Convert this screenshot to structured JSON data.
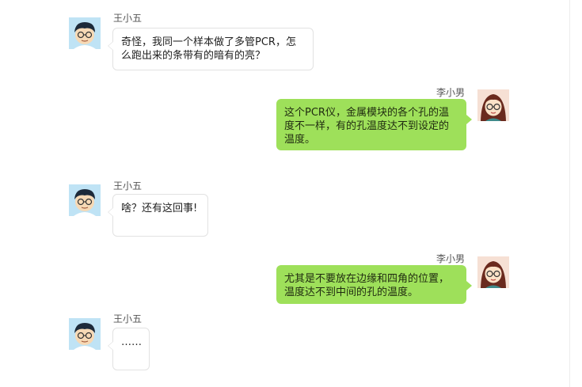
{
  "colors": {
    "left_bubble_bg": "#ffffff",
    "left_bubble_border": "#e2e2e2",
    "right_bubble_bg": "#9ee05a",
    "name_text": "#555555"
  },
  "participants": {
    "left": {
      "name": "王小五",
      "avatar_icon": "boy-with-glasses-avatar-icon"
    },
    "right": {
      "name": "李小男",
      "avatar_icon": "girl-with-glasses-avatar-icon"
    }
  },
  "messages": [
    {
      "side": "left",
      "name": "王小五",
      "text": "奇怪，我同一个样本做了多管PCR，怎么跑出来的条带有的暗有的亮？"
    },
    {
      "side": "right",
      "name": "李小男",
      "text": "这个PCR仪，金属模块的各个孔的温度不一样，有的孔温度达不到设定的温度。"
    },
    {
      "side": "left",
      "name": "王小五",
      "text": "啥？还有这回事!"
    },
    {
      "side": "right",
      "name": "李小男",
      "text": "尤其是不要放在边缘和四角的位置，温度达不到中间的孔的温度。"
    },
    {
      "side": "left",
      "name": "王小五",
      "text": "……"
    }
  ]
}
